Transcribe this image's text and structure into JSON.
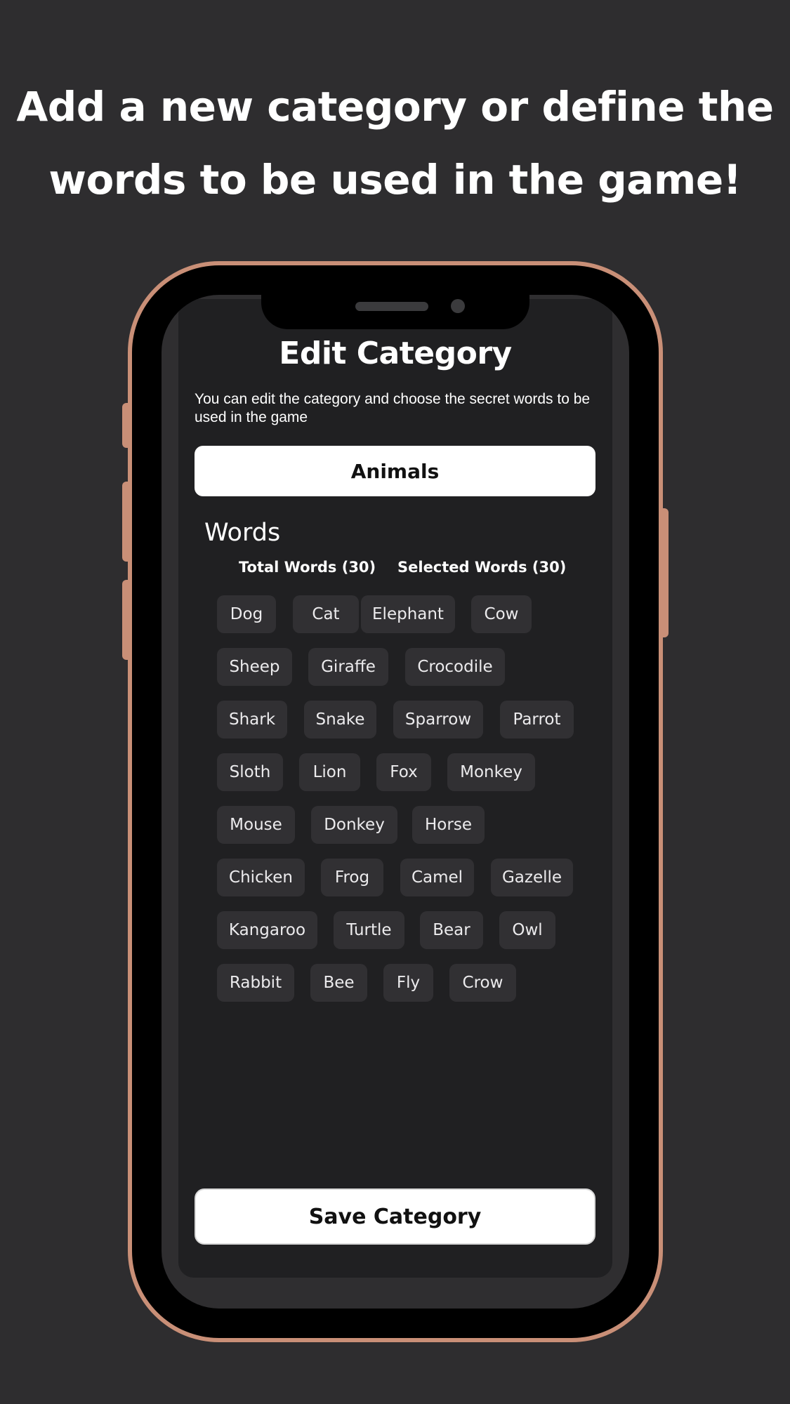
{
  "headline": {
    "line1": "Add a new category or define the",
    "line2": "words to be used in the game!"
  },
  "screen": {
    "title": "Edit Category",
    "description": "You can edit the category and choose the secret words to be used in the game",
    "category_name": "Animals",
    "words_heading": "Words",
    "total_words_label": "Total Words (30)",
    "selected_words_label": "Selected Words (30)",
    "words": [
      "Dog",
      "Cat",
      "Elephant",
      "Cow",
      "Sheep",
      "Giraffe",
      "Crocodile",
      "Shark",
      "Snake",
      "Sparrow",
      "Parrot",
      "Sloth",
      "Lion",
      "Fox",
      "Monkey",
      "Mouse",
      "Donkey",
      "Horse",
      "Chicken",
      "Frog",
      "Camel",
      "Gazelle",
      "Kangaroo",
      "Turtle",
      "Bear",
      "Owl",
      "Rabbit",
      "Bee",
      "Fly",
      "Crow"
    ],
    "save_label": "Save Category"
  },
  "colors": {
    "background": "#2e2d2f",
    "phone_frame": "#c98f77",
    "screen": "#202022",
    "chip": "#313033"
  }
}
